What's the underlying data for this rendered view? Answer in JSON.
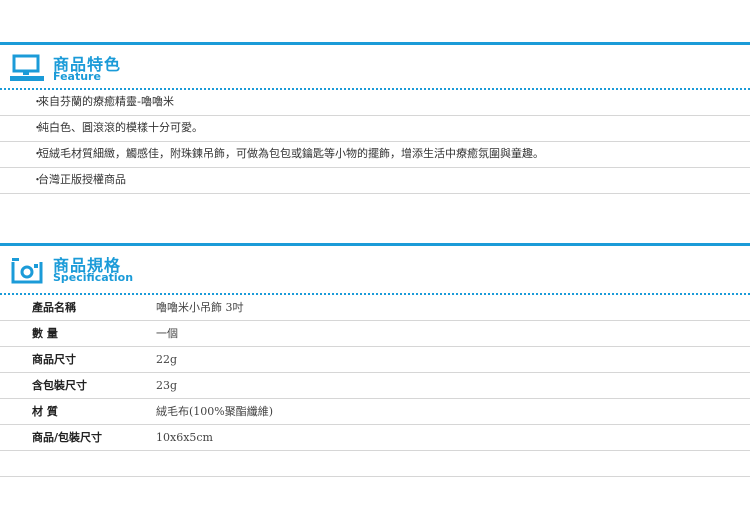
{
  "feature": {
    "title": "商品特色",
    "subtitle": "Feature",
    "items": [
      "來自芬蘭的療癒精靈-嚕嚕米",
      "純白色、圓滾滾的模樣十分可愛。",
      "短絨毛材質細緻，觸感佳，附珠鍊吊飾，可做為包包或鑰匙等小物的擺飾，增添生活中療癒氛圍與童趣。",
      "台灣正版授權商品"
    ]
  },
  "spec": {
    "title": "商品規格",
    "subtitle": "Specification",
    "rows": [
      {
        "label": "產品名稱",
        "value": "嚕嚕米小吊飾 3吋"
      },
      {
        "label": "數 量",
        "value": "一個"
      },
      {
        "label": "商品尺寸",
        "value": "22g"
      },
      {
        "label": "含包裝尺寸",
        "value": "23g"
      },
      {
        "label": "材 質",
        "value": "絨毛布(100%聚酯纖維)"
      },
      {
        "label": "商品/包裝尺寸",
        "value": "10x6x5cm"
      }
    ]
  },
  "bullet": "・",
  "accent_color": "#1b9bd8",
  "icons": [
    "monitor-icon",
    "camera-frame-icon"
  ]
}
